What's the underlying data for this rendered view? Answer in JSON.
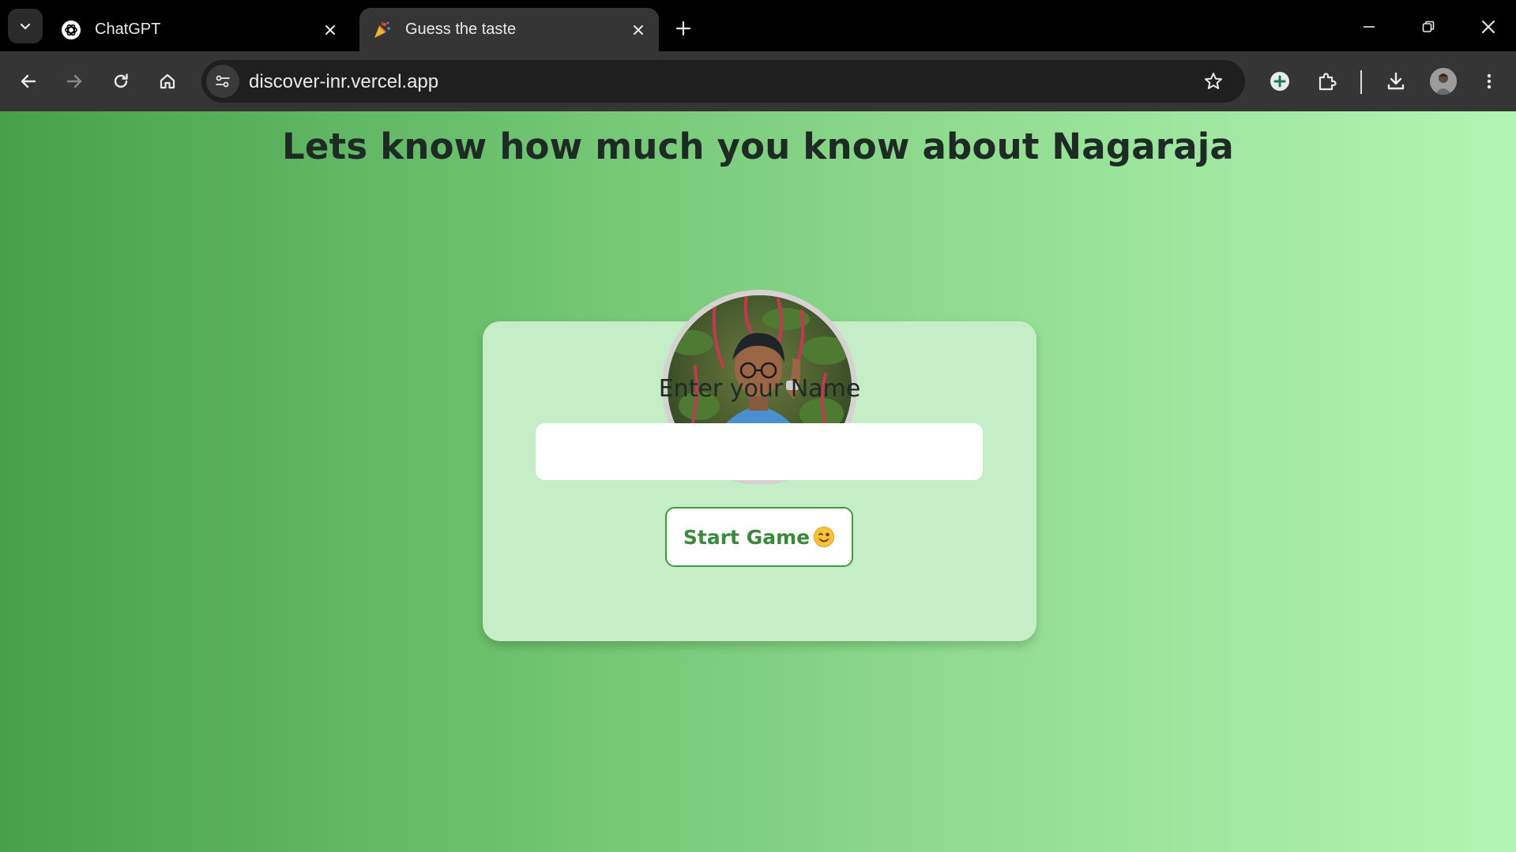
{
  "browser": {
    "tabs": [
      {
        "title": "ChatGPT",
        "favicon": "chatgpt-logo-icon",
        "active": false
      },
      {
        "title": "Guess the taste",
        "favicon": "party-popper-icon",
        "active": true
      }
    ],
    "url": "discover-inr.vercel.app",
    "colors": {
      "tabstrip": "#000000",
      "toolbar": "#353535",
      "omnibox": "#1f1f1f",
      "text": "#e8eaed"
    }
  },
  "page": {
    "heading": "Lets know how much you know about Nagaraja",
    "name_label": "Enter your Name",
    "name_input": {
      "value": "",
      "placeholder": ""
    },
    "start_button": {
      "label": "Start Game",
      "emoji": "winking-face-icon"
    },
    "colors": {
      "gradient_start": "#48a04a",
      "gradient_end": "#b2f5b4",
      "card": "#c5edc6",
      "button_text": "#3a8a3c"
    }
  }
}
